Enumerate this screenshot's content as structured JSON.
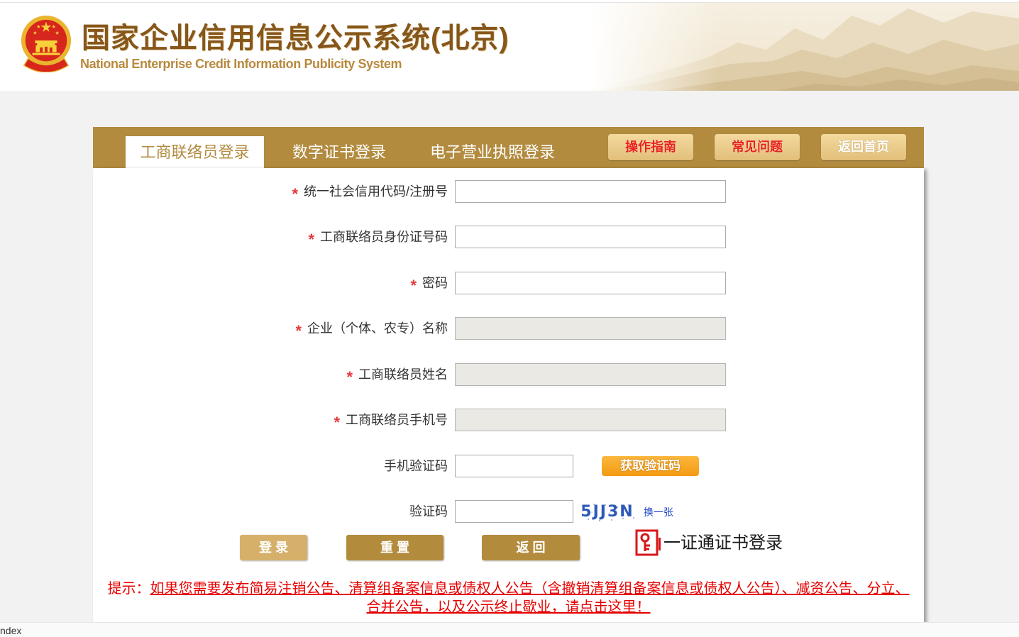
{
  "header": {
    "title": "国家企业信用信息公示系统(北京)",
    "subtitle": "National Enterprise Credit Information Publicity System",
    "emblem_icon": "national-emblem-icon"
  },
  "tabs": [
    {
      "label": "工商联络员登录",
      "active": true
    },
    {
      "label": "数字证书登录",
      "active": false
    },
    {
      "label": "电子营业执照登录",
      "active": false
    }
  ],
  "toolbar": {
    "guide": "操作指南",
    "faq": "常见问题",
    "home": "返回首页"
  },
  "form": {
    "required_mark": "*",
    "fields": [
      {
        "label": "统一社会信用代码/注册号",
        "value": "",
        "required": true,
        "disabled": false
      },
      {
        "label": "工商联络员身份证号码",
        "value": "",
        "required": true,
        "disabled": false
      },
      {
        "label": "密码",
        "value": "",
        "required": true,
        "disabled": false
      },
      {
        "label": "企业（个体、农专）名称",
        "value": "",
        "required": true,
        "disabled": true
      },
      {
        "label": "工商联络员姓名",
        "value": "",
        "required": true,
        "disabled": true
      },
      {
        "label": "工商联络员手机号",
        "value": "",
        "required": true,
        "disabled": true
      },
      {
        "label": "手机验证码",
        "value": "",
        "required": false,
        "disabled": false
      },
      {
        "label": "验证码",
        "value": "",
        "required": false,
        "disabled": false
      }
    ],
    "sms_button": "获取验证码",
    "captcha": {
      "text": "5JJ3N",
      "refresh": "换一张"
    }
  },
  "actions": {
    "login": "登 录",
    "reset": "重 置",
    "back": "返 回"
  },
  "cert_login": {
    "label": "一证通证书登录",
    "icon": "cert-key-icon"
  },
  "notice": {
    "prefix": "提示：",
    "link": "如果您需要发布简易注销公告、清算组备案信息或债权人公告（含撤销清算组备案信息或债权人公告）、减资公告、分立、合并公告，以及公示终止歇业，请点击这里！"
  },
  "status_bar": {
    "text": "ndex"
  },
  "colors": {
    "accent_gold": "#b28b3f",
    "light_button": "#d6b06a",
    "sms_button": "#f5a11c",
    "required_mark": "#e3393c",
    "notice_red": "#e60000",
    "link_blue": "#1d44c8",
    "toolbar_red_text": "#e8231c"
  }
}
